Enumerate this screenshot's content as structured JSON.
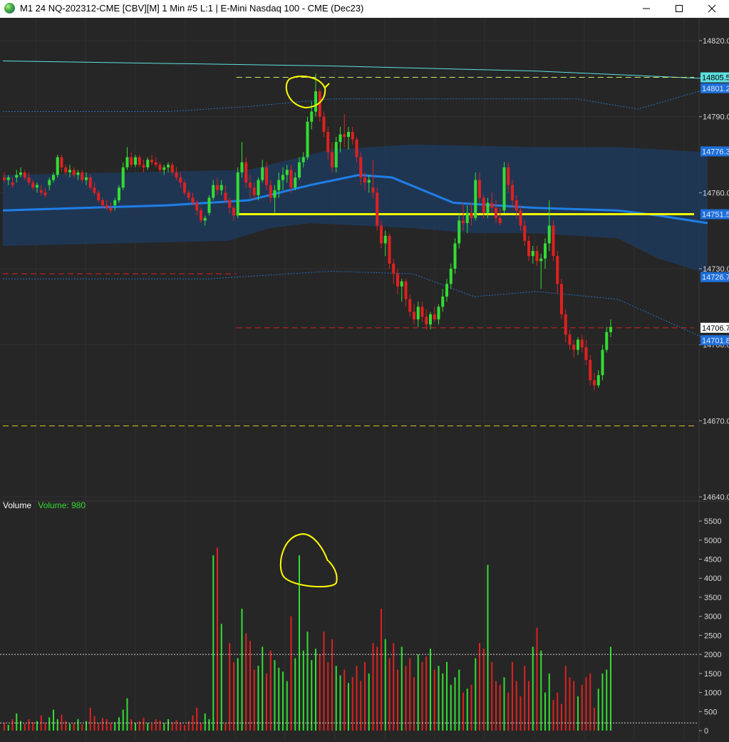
{
  "window": {
    "title": "M1 24 NQ-202312-CME [CBV][M]  1 Min  #5 L:1 | E-Mini Nasdaq 100 - CME (Dec23)",
    "icons": [
      "globe-icon",
      "minimize-icon",
      "maximize-icon",
      "close-icon"
    ]
  },
  "colors": {
    "background": "#262626",
    "up": "#33dd33",
    "down": "#e02020",
    "band": "#1f3a5c",
    "vwap": "#1e7fe8",
    "upper_line": "#5fe0e0",
    "annotation": "#ffff00"
  },
  "volume_legend": {
    "name": "Volume",
    "value_text": "Volume: 980"
  },
  "price_labels": [
    {
      "text": "14805.5",
      "value": 14805.5,
      "style": "cyan"
    },
    {
      "text": "14801.2",
      "value": 14801.2,
      "style": "blue"
    },
    {
      "text": "14776.3",
      "value": 14776.3,
      "style": "blue"
    },
    {
      "text": "14751.5",
      "value": 14751.5,
      "style": "blue"
    },
    {
      "text": "14726.7",
      "value": 14726.7,
      "style": "blue"
    },
    {
      "text": "14706.7",
      "value": 14706.7,
      "style": "white"
    },
    {
      "text": "14701.8",
      "value": 14701.8,
      "style": "blue"
    }
  ],
  "chart_data": [
    {
      "type": "candlestick",
      "title": "",
      "ylim": [
        14640,
        14829
      ],
      "y_ticks": [
        14640,
        14670,
        14700,
        14730,
        14760,
        14790,
        14820
      ],
      "y_tick_labels": [
        "14640.0",
        "14670.0",
        "14700.0",
        "14730.0",
        "14760.0",
        "14790.0",
        "14820.0"
      ],
      "grid": true,
      "vwap": [
        [
          0,
          14753
        ],
        [
          20,
          14754
        ],
        [
          40,
          14755
        ],
        [
          60,
          14757
        ],
        [
          75,
          14763
        ],
        [
          87,
          14767
        ],
        [
          95,
          14766
        ],
        [
          110,
          14756
        ],
        [
          130,
          14754
        ],
        [
          150,
          14753
        ],
        [
          160,
          14751
        ],
        [
          172,
          14748
        ]
      ],
      "band_upper": [
        [
          0,
          14767
        ],
        [
          60,
          14769
        ],
        [
          80,
          14777
        ],
        [
          100,
          14779
        ],
        [
          130,
          14778
        ],
        [
          150,
          14778
        ],
        [
          172,
          14776
        ]
      ],
      "band_lower": [
        [
          0,
          14739
        ],
        [
          55,
          14741
        ],
        [
          65,
          14746
        ],
        [
          75,
          14748
        ],
        [
          100,
          14746
        ],
        [
          115,
          14744
        ],
        [
          130,
          14744
        ],
        [
          150,
          14742
        ],
        [
          160,
          14734
        ],
        [
          172,
          14728
        ]
      ],
      "outer_upper": [
        [
          0,
          14792
        ],
        [
          40,
          14792
        ],
        [
          60,
          14794
        ],
        [
          80,
          14797
        ],
        [
          120,
          14797
        ],
        [
          140,
          14797
        ],
        [
          155,
          14793
        ],
        [
          172,
          14801
        ]
      ],
      "outer_lower": [
        [
          0,
          14726
        ],
        [
          50,
          14726
        ],
        [
          60,
          14727
        ],
        [
          80,
          14729
        ],
        [
          100,
          14728
        ],
        [
          115,
          14719
        ],
        [
          130,
          14721
        ],
        [
          150,
          14718
        ],
        [
          172,
          14702
        ]
      ],
      "upper_line": [
        [
          0,
          14812
        ],
        [
          80,
          14810
        ],
        [
          130,
          14808
        ],
        [
          172,
          14805
        ]
      ],
      "hlines": [
        {
          "y": 14805.5,
          "color": "#c8f060",
          "dash": true,
          "x_start": 57
        },
        {
          "y": 14751.5,
          "color": "#ffff00",
          "dash": false,
          "x_start": 57,
          "width": 3
        },
        {
          "y": 14706.7,
          "color": "#e02020",
          "dash": true,
          "x_start": 57
        },
        {
          "y": 14728,
          "color": "#e02020",
          "dash": true,
          "x_start": 0,
          "x_end": 57
        },
        {
          "y": 14668,
          "color": "#d8c020",
          "dash": true,
          "x_start": 0
        }
      ],
      "candles": [
        [
          14766,
          14768,
          14764,
          14765
        ],
        [
          14765,
          14767,
          14763,
          14766
        ],
        [
          14764,
          14766,
          14762,
          14763
        ],
        [
          14766,
          14769,
          14764,
          14767
        ],
        [
          14767,
          14770,
          14766,
          14768
        ],
        [
          14768,
          14769,
          14765,
          14766
        ],
        [
          14766,
          14768,
          14763,
          14764
        ],
        [
          14764,
          14765,
          14761,
          14762
        ],
        [
          14762,
          14764,
          14760,
          14763
        ],
        [
          14761,
          14763,
          14759,
          14760
        ],
        [
          14760,
          14762,
          14758,
          14759
        ],
        [
          14763,
          14766,
          14761,
          14765
        ],
        [
          14765,
          14768,
          14764,
          14767
        ],
        [
          14767,
          14775,
          14766,
          14774
        ],
        [
          14774,
          14775,
          14768,
          14770
        ],
        [
          14770,
          14771,
          14767,
          14768
        ],
        [
          14768,
          14771,
          14766,
          14769
        ],
        [
          14769,
          14770,
          14766,
          14767
        ],
        [
          14767,
          14769,
          14765,
          14768
        ],
        [
          14768,
          14769,
          14764,
          14765
        ],
        [
          14765,
          14768,
          14763,
          14766
        ],
        [
          14766,
          14767,
          14761,
          14762
        ],
        [
          14762,
          14764,
          14759,
          14760
        ],
        [
          14760,
          14761,
          14756,
          14757
        ],
        [
          14757,
          14758,
          14754,
          14755
        ],
        [
          14755,
          14757,
          14753,
          14754
        ],
        [
          14754,
          14756,
          14752,
          14753
        ],
        [
          14755,
          14758,
          14753,
          14757
        ],
        [
          14757,
          14763,
          14756,
          14762
        ],
        [
          14762,
          14772,
          14761,
          14770
        ],
        [
          14770,
          14778,
          14769,
          14774
        ],
        [
          14774,
          14776,
          14770,
          14771
        ],
        [
          14771,
          14775,
          14770,
          14774
        ],
        [
          14774,
          14775,
          14770,
          14771
        ],
        [
          14771,
          14773,
          14768,
          14770
        ],
        [
          14770,
          14774,
          14769,
          14773
        ],
        [
          14773,
          14775,
          14771,
          14772
        ],
        [
          14772,
          14774,
          14770,
          14771
        ],
        [
          14771,
          14772,
          14768,
          14769
        ],
        [
          14769,
          14771,
          14767,
          14770
        ],
        [
          14770,
          14772,
          14768,
          14771
        ],
        [
          14771,
          14772,
          14767,
          14768
        ],
        [
          14768,
          14770,
          14765,
          14766
        ],
        [
          14766,
          14768,
          14762,
          14764
        ],
        [
          14764,
          14765,
          14759,
          14760
        ],
        [
          14760,
          14761,
          14757,
          14758
        ],
        [
          14758,
          14760,
          14755,
          14756
        ],
        [
          14756,
          14757,
          14751,
          14753
        ],
        [
          14753,
          14754,
          14748,
          14749
        ],
        [
          14749,
          14751,
          14747,
          14750
        ],
        [
          14752,
          14759,
          14751,
          14758
        ],
        [
          14758,
          14765,
          14757,
          14763
        ],
        [
          14763,
          14766,
          14759,
          14761
        ],
        [
          14761,
          14765,
          14759,
          14763
        ],
        [
          14760,
          14763,
          14756,
          14757
        ],
        [
          14757,
          14758,
          14752,
          14754
        ],
        [
          14754,
          14755,
          14749,
          14751
        ],
        [
          14751,
          14770,
          14750,
          14768
        ],
        [
          14768,
          14780,
          14766,
          14772
        ],
        [
          14772,
          14774,
          14762,
          14764
        ],
        [
          14764,
          14767,
          14758,
          14762
        ],
        [
          14762,
          14764,
          14757,
          14759
        ],
        [
          14759,
          14766,
          14757,
          14765
        ],
        [
          14765,
          14773,
          14764,
          14770
        ],
        [
          14770,
          14772,
          14761,
          14763
        ],
        [
          14763,
          14765,
          14756,
          14758
        ],
        [
          14758,
          14763,
          14752,
          14761
        ],
        [
          14761,
          14768,
          14758,
          14765
        ],
        [
          14765,
          14770,
          14761,
          14767
        ],
        [
          14767,
          14771,
          14764,
          14769
        ],
        [
          14769,
          14771,
          14760,
          14762
        ],
        [
          14762,
          14768,
          14761,
          14766
        ],
        [
          14766,
          14774,
          14765,
          14772
        ],
        [
          14772,
          14776,
          14770,
          14774
        ],
        [
          14774,
          14790,
          14773,
          14788
        ],
        [
          14788,
          14796,
          14785,
          14792
        ],
        [
          14792,
          14807,
          14790,
          14800
        ],
        [
          14800,
          14801,
          14788,
          14790
        ],
        [
          14790,
          14792,
          14782,
          14784
        ],
        [
          14784,
          14786,
          14773,
          14776
        ],
        [
          14776,
          14780,
          14768,
          14770
        ],
        [
          14770,
          14782,
          14768,
          14780
        ],
        [
          14780,
          14786,
          14776,
          14783
        ],
        [
          14783,
          14791,
          14778,
          14782
        ],
        [
          14782,
          14786,
          14777,
          14784
        ],
        [
          14784,
          14786,
          14779,
          14781
        ],
        [
          14781,
          14782,
          14772,
          14774
        ],
        [
          14774,
          14776,
          14763,
          14766
        ],
        [
          14766,
          14768,
          14761,
          14764
        ],
        [
          14764,
          14767,
          14760,
          14765
        ],
        [
          14762,
          14773,
          14758,
          14760
        ],
        [
          14760,
          14762,
          14745,
          14747
        ],
        [
          14747,
          14749,
          14738,
          14740
        ],
        [
          14740,
          14745,
          14735,
          14743
        ],
        [
          14743,
          14744,
          14730,
          14732
        ],
        [
          14732,
          14734,
          14724,
          14728
        ],
        [
          14728,
          14730,
          14720,
          14723
        ],
        [
          14723,
          14726,
          14717,
          14725
        ],
        [
          14725,
          14726,
          14715,
          14718
        ],
        [
          14718,
          14720,
          14711,
          14713
        ],
        [
          14713,
          14716,
          14708,
          14710
        ],
        [
          14710,
          14717,
          14707,
          14715
        ],
        [
          14715,
          14717,
          14709,
          14711
        ],
        [
          14711,
          14714,
          14706,
          14708
        ],
        [
          14708,
          14713,
          14706,
          14712
        ],
        [
          14712,
          14715,
          14709,
          14710
        ],
        [
          14710,
          14716,
          14708,
          14715
        ],
        [
          14715,
          14722,
          14713,
          14719
        ],
        [
          14719,
          14726,
          14717,
          14724
        ],
        [
          14724,
          14732,
          14722,
          14730
        ],
        [
          14730,
          14742,
          14728,
          14740
        ],
        [
          14740,
          14752,
          14738,
          14749
        ],
        [
          14749,
          14756,
          14745,
          14748
        ],
        [
          14748,
          14755,
          14744,
          14752
        ],
        [
          14752,
          14756,
          14747,
          14750
        ],
        [
          14750,
          14768,
          14749,
          14765
        ],
        [
          14765,
          14768,
          14756,
          14758
        ],
        [
          14758,
          14759,
          14750,
          14752
        ],
        [
          14752,
          14758,
          14750,
          14756
        ],
        [
          14756,
          14760,
          14752,
          14754
        ],
        [
          14754,
          14757,
          14748,
          14750
        ],
        [
          14750,
          14754,
          14747,
          14748
        ],
        [
          14753,
          14772,
          14752,
          14770
        ],
        [
          14770,
          14772,
          14760,
          14763
        ],
        [
          14763,
          14765,
          14754,
          14757
        ],
        [
          14757,
          14759,
          14750,
          14753
        ],
        [
          14753,
          14755,
          14745,
          14747
        ],
        [
          14747,
          14749,
          14739,
          14741
        ],
        [
          14741,
          14743,
          14733,
          14735
        ],
        [
          14735,
          14739,
          14732,
          14737
        ],
        [
          14737,
          14739,
          14731,
          14733
        ],
        [
          14733,
          14736,
          14722,
          14734
        ],
        [
          14734,
          14742,
          14730,
          14740
        ],
        [
          14740,
          14757,
          14737,
          14747
        ],
        [
          14747,
          14749,
          14733,
          14735
        ],
        [
          14735,
          14737,
          14720,
          14724
        ],
        [
          14724,
          14726,
          14710,
          14712
        ],
        [
          14712,
          14714,
          14701,
          14704
        ],
        [
          14704,
          14706,
          14698,
          14700
        ],
        [
          14700,
          14702,
          14695,
          14698
        ],
        [
          14698,
          14703,
          14696,
          14702
        ],
        [
          14702,
          14704,
          14697,
          14699
        ],
        [
          14699,
          14702,
          14692,
          14694
        ],
        [
          14694,
          14696,
          14684,
          14686
        ],
        [
          14686,
          14689,
          14682,
          14684
        ],
        [
          14684,
          14690,
          14683,
          14688
        ],
        [
          14688,
          14700,
          14686,
          14698
        ],
        [
          14698,
          14707,
          14697,
          14705
        ],
        [
          14705,
          14710,
          14703,
          14707
        ]
      ],
      "x_offset": 0,
      "bar_spacing": 5.75
    },
    {
      "type": "bar",
      "title": "Volume",
      "ylim": [
        0,
        5800
      ],
      "y_ticks": [
        0,
        500,
        1000,
        1500,
        2000,
        2500,
        3000,
        3500,
        4000,
        4500,
        5000,
        5500
      ],
      "y_tick_labels": [
        "0",
        "500",
        "1000",
        "1500",
        "2000",
        "2500",
        "3000",
        "3500",
        "4000",
        "4500",
        "5000",
        "5500"
      ],
      "reference_lines": [
        2000,
        200
      ],
      "last_value": 980
    }
  ]
}
